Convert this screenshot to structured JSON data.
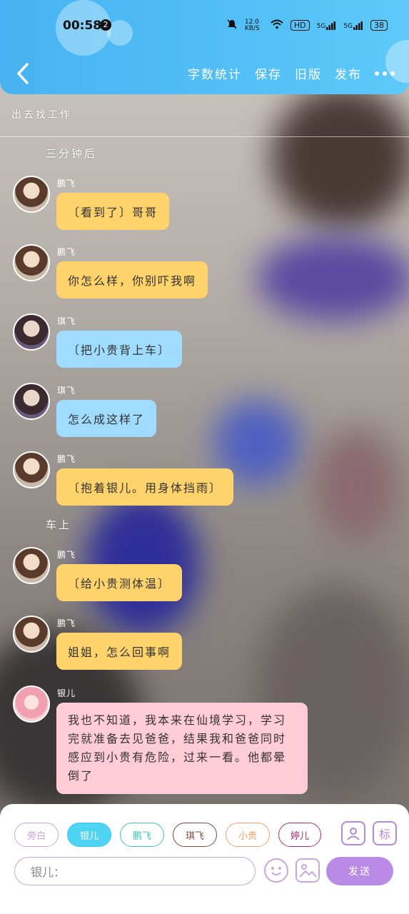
{
  "status": {
    "time": "00:58",
    "notif_count": "2",
    "net_speed": "12.0 KB/S",
    "hd": "HD",
    "sig1": "5G",
    "sig2": "5G",
    "battery": "38"
  },
  "nav": {
    "word_count": "字数统计",
    "save": "保存",
    "old_version": "旧版",
    "publish": "发布"
  },
  "story_title": "出去找工作",
  "asides": [
    "三分钟后",
    "车上"
  ],
  "messages": [
    {
      "name": "鹏飞",
      "text": "〔看到了〕哥哥",
      "color": "#ffd36b"
    },
    {
      "name": "鹏飞",
      "text": "你怎么样，你别吓我啊",
      "color": "#ffd36b"
    },
    {
      "name": "琪飞",
      "text": "〔把小贵背上车〕",
      "color": "#9fdcff"
    },
    {
      "name": "琪飞",
      "text": "怎么成这样了",
      "color": "#9fdcff"
    },
    {
      "name": "鹏飞",
      "text": "〔抱着银儿。用身体挡雨〕",
      "color": "#ffd36b"
    },
    {
      "name": "鹏飞",
      "text": "〔给小贵测体温〕",
      "color": "#ffd36b"
    },
    {
      "name": "鹏飞",
      "text": "姐姐，怎么回事啊",
      "color": "#ffd36b"
    },
    {
      "name": "银儿",
      "text": "我也不知道，我本来在仙境学习，学习完就准备去见爸爸，结果我和爸爸同时感应到小贵有危险，过来一看。他都晕倒了",
      "color": "#ffccd8"
    }
  ],
  "chips": [
    {
      "label": "旁白",
      "color": "#c9a6e0"
    },
    {
      "label": "银儿",
      "color": "#38c9ee"
    },
    {
      "label": "鹏飞",
      "color": "#3cc4b8"
    },
    {
      "label": "琪飞",
      "color": "#7a4a3a"
    },
    {
      "label": "小贵",
      "color": "#f0a070"
    },
    {
      "label": "婷儿",
      "color": "#a03070"
    }
  ],
  "tool_icon_2": "标",
  "input": {
    "placeholder": "银儿："
  },
  "send_label": "发送"
}
